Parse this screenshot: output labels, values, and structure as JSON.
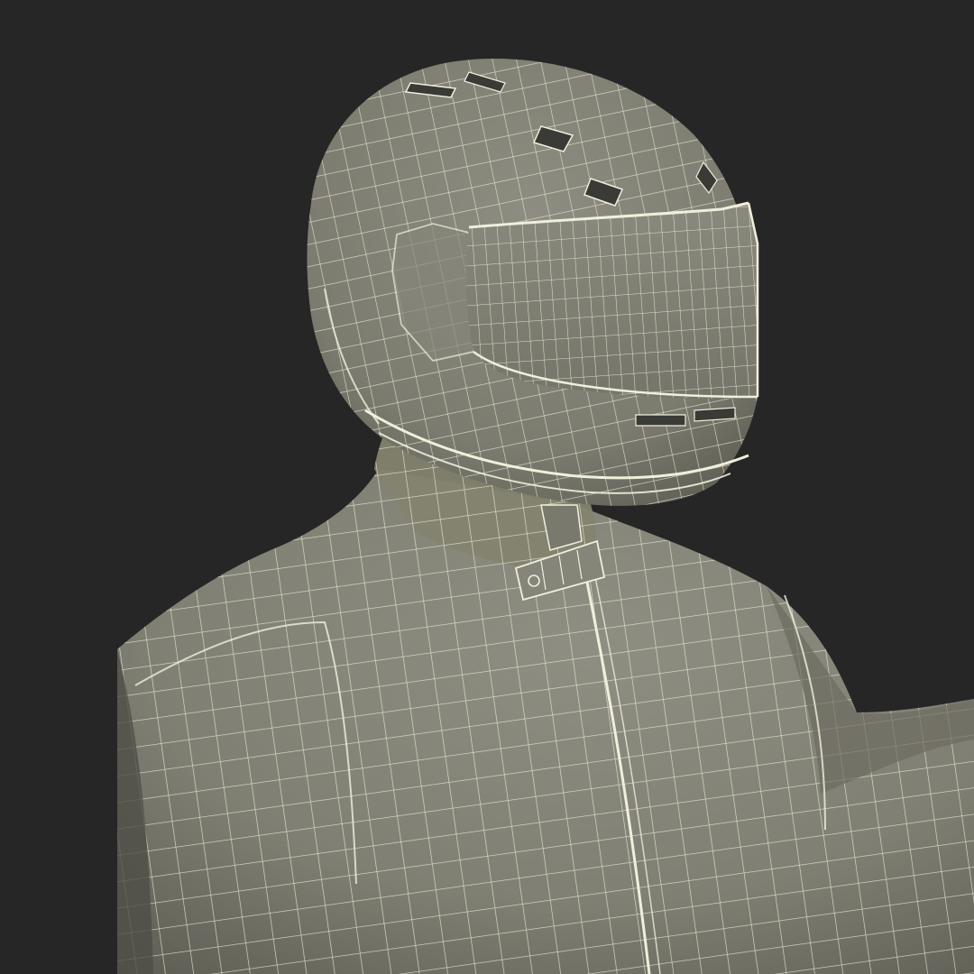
{
  "scene": {
    "subject": "wireframe-motorcycle-rider",
    "colors": {
      "background": "#262626",
      "surface_light": "#8f8e82",
      "surface_mid": "#7d7c70",
      "surface_dark": "#5d5c53",
      "wire": "#f1efdc",
      "visor_slot": "#3a3a36"
    }
  }
}
